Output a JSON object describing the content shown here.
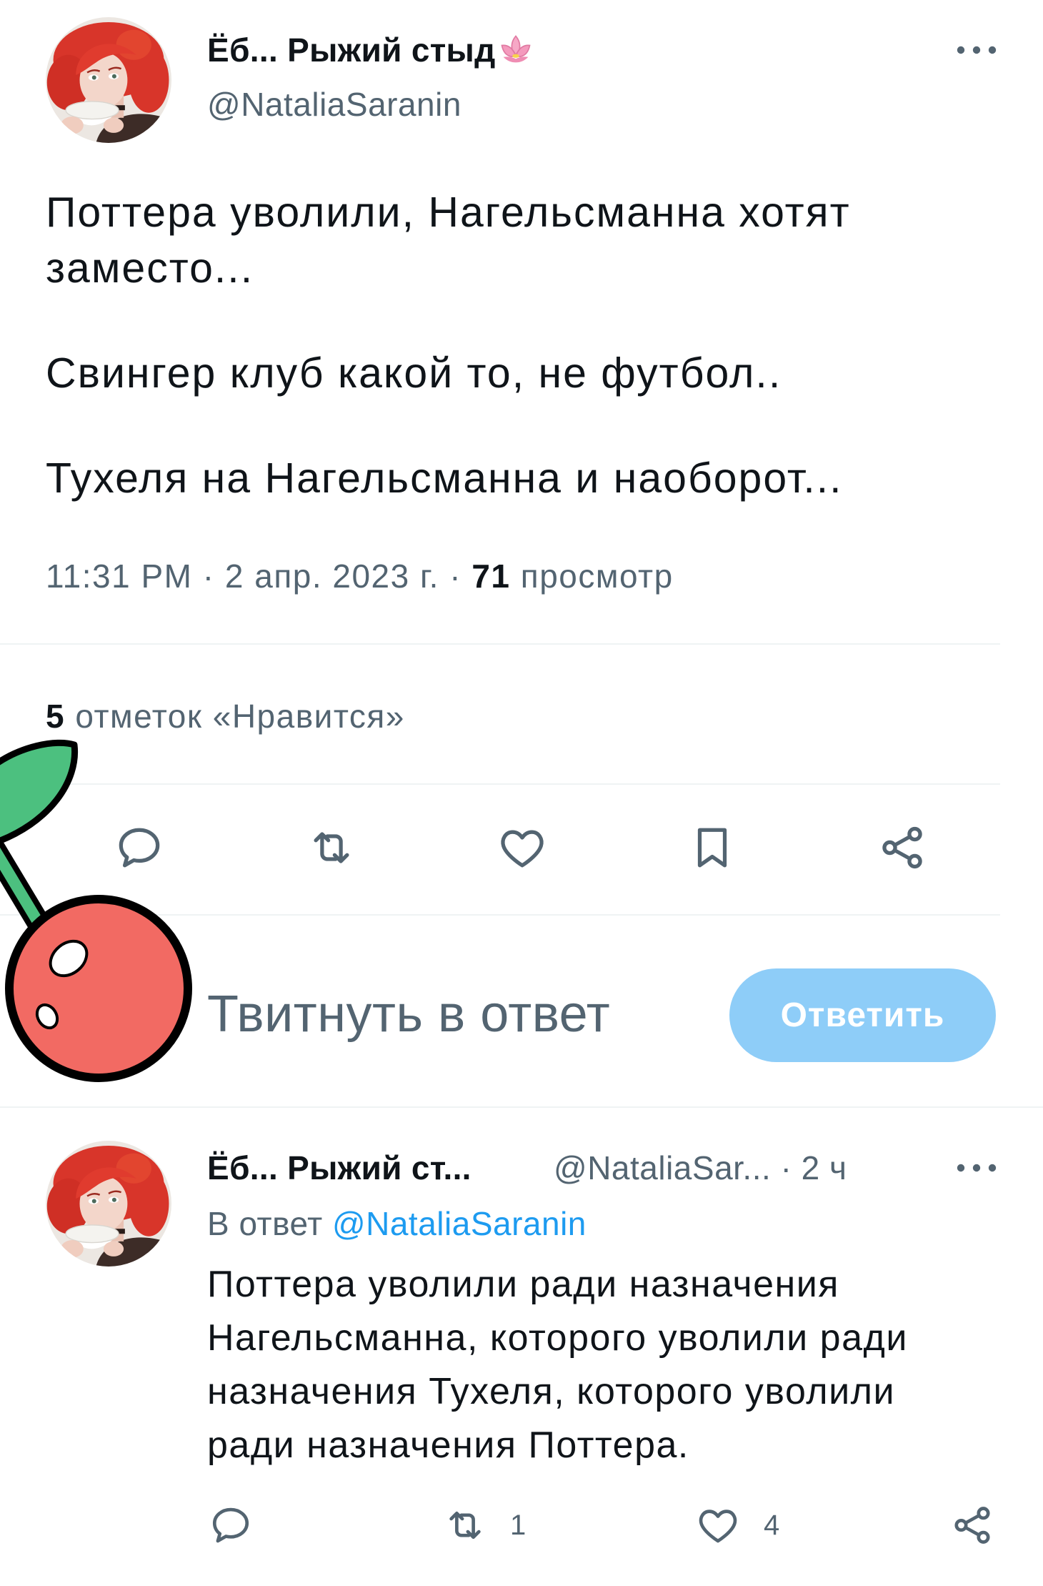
{
  "tweet": {
    "author": {
      "name": "Ёб... Рыжий стыд",
      "name_emoji_icon": "lotus-icon",
      "handle": "@NataliaSaranin"
    },
    "more_icon": "more-icon",
    "body": [
      [
        "Поттера уволили, Нагельсманна хотят",
        "заместо..."
      ],
      [
        "Свингер клуб какой то, не футбол.."
      ],
      [
        "Тухеля на Нагельсманна и наоборот..."
      ]
    ],
    "meta": {
      "time": "11:31 PM",
      "separator": "·",
      "date": "2 апр. 2023 г.",
      "views_count": "71",
      "views_label": "просмотр"
    },
    "likes": {
      "count": "5",
      "label": "отметок «Нравится»"
    },
    "action_icons": [
      "reply-icon",
      "retweet-icon",
      "like-icon",
      "bookmark-icon",
      "share-icon"
    ]
  },
  "composer": {
    "placeholder": "Твитнуть в ответ",
    "submit_label": "Ответить"
  },
  "reply": {
    "author": {
      "name": "Ёб... Рыжий ст...",
      "handle": "@NataliaSar...",
      "separator": "·",
      "time": "2 ч"
    },
    "in_reply_to": {
      "prefix": "В ответ",
      "mention": "@NataliaSaranin"
    },
    "body": [
      "Поттера уволили ради назначения",
      "Нагельсманна, которого уволили ради",
      "назначения Тухеля, которого уволили",
      "ради назначения Поттера."
    ],
    "stats": {
      "retweets": "1",
      "likes": "4"
    },
    "action_icons": [
      "reply-icon",
      "retweet-icon",
      "like-icon",
      "share-icon"
    ]
  },
  "sticker": {
    "icon": "cherry-sticker"
  },
  "colors": {
    "text": "#0f1419",
    "secondary_text": "#536471",
    "link": "#1d9bf0",
    "button_disabled": "#8ecdf8",
    "divider": "#eff3f4",
    "cherry": "#f26a63",
    "leaf": "#4cc07f",
    "hair": "#d4372b"
  }
}
